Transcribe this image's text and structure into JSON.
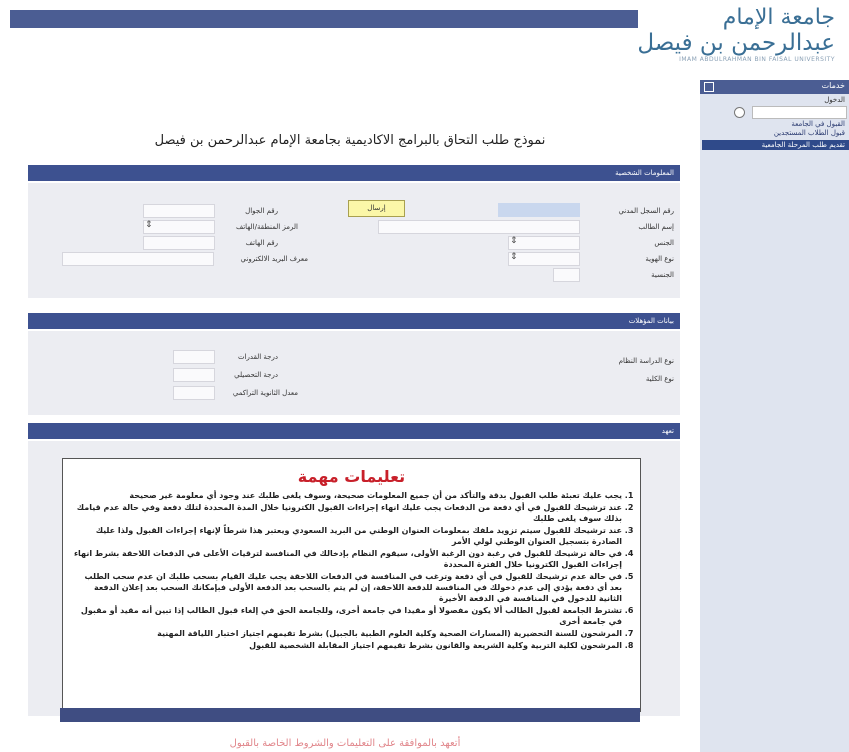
{
  "header": {
    "university_name_line1": "جامعة الإمام",
    "university_name_line2": "عبدالرحمن بن فيصل",
    "university_name_english": "IMAM ABDULRAHMAN BIN FAISAL UNIVERSITY"
  },
  "sidebar": {
    "title": "خدمات",
    "small_label": "الدخول",
    "links": [
      "القبول في الجامعة",
      "قبول الطلاب المستجدين"
    ],
    "selected_item": "تقديم طلب المرحلة الجامعية"
  },
  "form_title": "نموذج طلب التحاق بالبرامج الاكاديمية بجامعة الإمام عبدالرحمن بن فيصل",
  "personal": {
    "section_title": "المعلومات الشخصية",
    "send_button": "إرسال",
    "labels": {
      "civil_record": "رقم السجل المدني",
      "student_name": "إسم الطالب",
      "gender": "الجنس",
      "id_type": "نوع الهوية",
      "nationality": "الجنسية",
      "mobile": "رقم الجوال",
      "region_code": "الرمز المنطقة/الهاتف",
      "phone": "رقم الهاتف",
      "email": "معرف البريد الالكتروني"
    }
  },
  "qualifications": {
    "section_title": "بيانات المؤهلات",
    "labels": {
      "study_type": "نوع الدراسة النظام",
      "college_type": "نوع الكلية",
      "abilities_score": "درجة القدرات",
      "achievement_score": "درجة التحصيلي",
      "high_school_gpa": "معدل الثانوية التراكمي"
    }
  },
  "pledge": {
    "section_title": "تعهد",
    "notice_title": "تعليمات مهمة",
    "instructions": [
      "يجب عليك تعبئة طلب القبول بدقة والتأكد من أن جميع المعلومات صحيحة، وسوف يلغى طلبك عند وجود أي معلومة غير صحيحة",
      "عند ترشيحك للقبول في أي دفعة من الدفعات يجب عليك انهاء إجراءات القبول الكترونيا خلال المدة المحددة لتلك دفعة وفي حالة عدم قيامك بذلك سوف يلغى طلبك",
      "عند ترشيحك للقبول سيتم تزويد ملفك بمعلومات العنوان الوطني من البريد السعودي ويعتبر هذا شرطاً لإنهاء إجراءات القبول ولذا عليك الصادرة بتسجيل العنوان الوطني لولي الأمر",
      "في حالة ترشيحك للقبول في رغبة دون الرغبة الأولى، سيقوم النظام بإدخالك في المنافسة لترقيات الأعلى في الدفعات اللاحقة بشرط انهاء إجراءات القبول الكترونيا خلال الفترة المحددة",
      "في حالة عدم ترشيحك للقبول في أي دفعة وترغب في المنافسة في الدفعات اللاحقة يجب عليك القيام بسحب طلبك ان عدم سحب الطلب بعد أي دفعة يؤدي إلى عدم دخولك في المنافسة للدفعة اللاحقة، إن لم يتم بالسحب بعد الدفعة الأولى فبإمكانك السحب بعد إعلان الدفعة الثانية للدخول في المنافسة في الدفعة الأخيرة",
      "تشترط الجامعة لقبول الطالب ألا يكون مفصولا أو مقيدا في جامعة أخرى، وللجامعة الحق في إلغاء قبول الطالب إذا تبين أنه مقيد أو مقبول في جامعة أخرى",
      "المرشحون للسنة التحضيرية (المسارات الصحية وكلية العلوم الطبية بالجبيل) بشرط تقيمهم اجتياز اختبار اللياقة المهنية",
      "المرشحون لكلية التربية وكلية الشريعة والقانون بشرط تقيمهم اجتياز المقابلة الشخصية للقبول"
    ],
    "agree_text": "أتعهد بالموافقة على التعليمات والشروط الخاصة بالقبول"
  }
}
